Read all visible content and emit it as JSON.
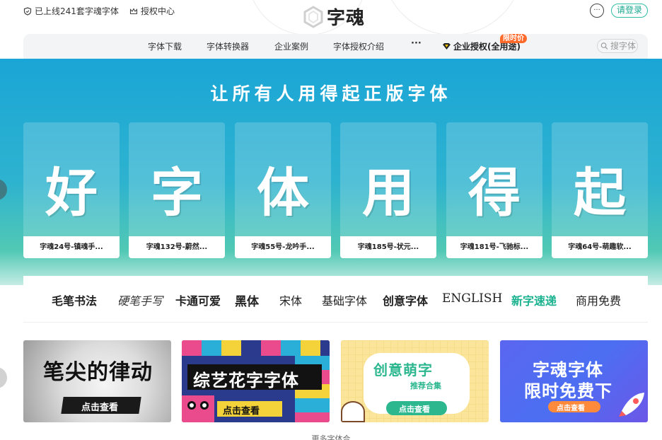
{
  "topbar": {
    "online_text": "已上线241套字魂字体",
    "auth_center": "授权中心",
    "logo_text": "字魂",
    "login_label": "请登录"
  },
  "nav": {
    "items": [
      "字体下载",
      "字体转换器",
      "企业案例",
      "字体授权介绍"
    ],
    "more": "···",
    "vip_label": "企业授权(全用途)",
    "sale_badge": "限时价",
    "search_placeholder": "搜字体"
  },
  "banner": {
    "title": "让所有人用得起正版字体",
    "cards": [
      {
        "glyph": "好",
        "name": "字魂24号-镇魂手..."
      },
      {
        "glyph": "字",
        "name": "字魂132号-蔚然..."
      },
      {
        "glyph": "体",
        "name": "字魂55号-龙吟手..."
      },
      {
        "glyph": "用",
        "name": "字魂185号-状元..."
      },
      {
        "glyph": "得",
        "name": "字魂181号-飞驰标..."
      },
      {
        "glyph": "起",
        "name": "字魂64号-萌趣软..."
      }
    ]
  },
  "categories": [
    "毛笔书法",
    "硬笔手写",
    "卡通可爱",
    "黑体",
    "宋体",
    "基础字体",
    "创意字体",
    "ENGLISH",
    "新字速递",
    "商用免费"
  ],
  "promos": [
    {
      "title": "笔尖的律动",
      "cta": "点击查看"
    },
    {
      "title": "综艺花字字体",
      "cta": "点击查看"
    },
    {
      "title": "创意萌字",
      "subtitle": "推荐合集",
      "cta": "点击查看"
    },
    {
      "title": "字魂字体",
      "title2": "限时免费下",
      "cta": "点击查看"
    }
  ],
  "footer": {
    "more_fonts": "更多字体合"
  },
  "colors": {
    "accent": "#2fbea5",
    "banner_top": "#1aa5d6",
    "badge": "#ff6a2b",
    "new_fonts": "#1bb28f"
  }
}
